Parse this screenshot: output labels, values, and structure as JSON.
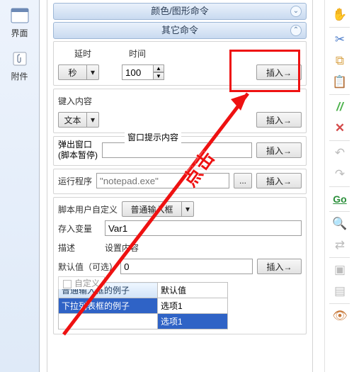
{
  "left": {
    "ui": "界面",
    "attach": "附件"
  },
  "bars": {
    "color_cmd": "颜色/图形命令",
    "other_cmd": "其它命令"
  },
  "delay_time": {
    "delay_hdr": "延时",
    "time_hdr": "时间",
    "unit": "秒",
    "value": "100",
    "insert": "插入→"
  },
  "key_content": {
    "hdr": "键入内容",
    "type": "文本",
    "insert": "插入→"
  },
  "popup": {
    "group_title": "窗口提示内容",
    "line1": "弹出窗口",
    "line2": "(脚本暂停)",
    "insert": "插入→"
  },
  "run": {
    "hdr": "运行程序",
    "placeholder": "\"notepad.exe\"",
    "browse": "...",
    "insert": "插入→"
  },
  "userdef": {
    "hdr": "脚本用户自定义",
    "mode": "普通输入框",
    "save_as": "存入变量",
    "var": "Var1",
    "desc_hdr": "描述",
    "desc_val": "设置内容",
    "default_hdr": "默认值（可选）",
    "default_val": "0",
    "insert": "插入→"
  },
  "tab": {
    "title": "自定义",
    "r1c1": "普通输入框的例子",
    "r1c2": "默认值",
    "r2c1": "下拉列表框的例子",
    "r2c2": "选项1",
    "r3c2": "选项1"
  },
  "anno": {
    "click": "点击"
  },
  "dd_arrow": "▾",
  "spin_up": "▲",
  "spin_down": "▼"
}
